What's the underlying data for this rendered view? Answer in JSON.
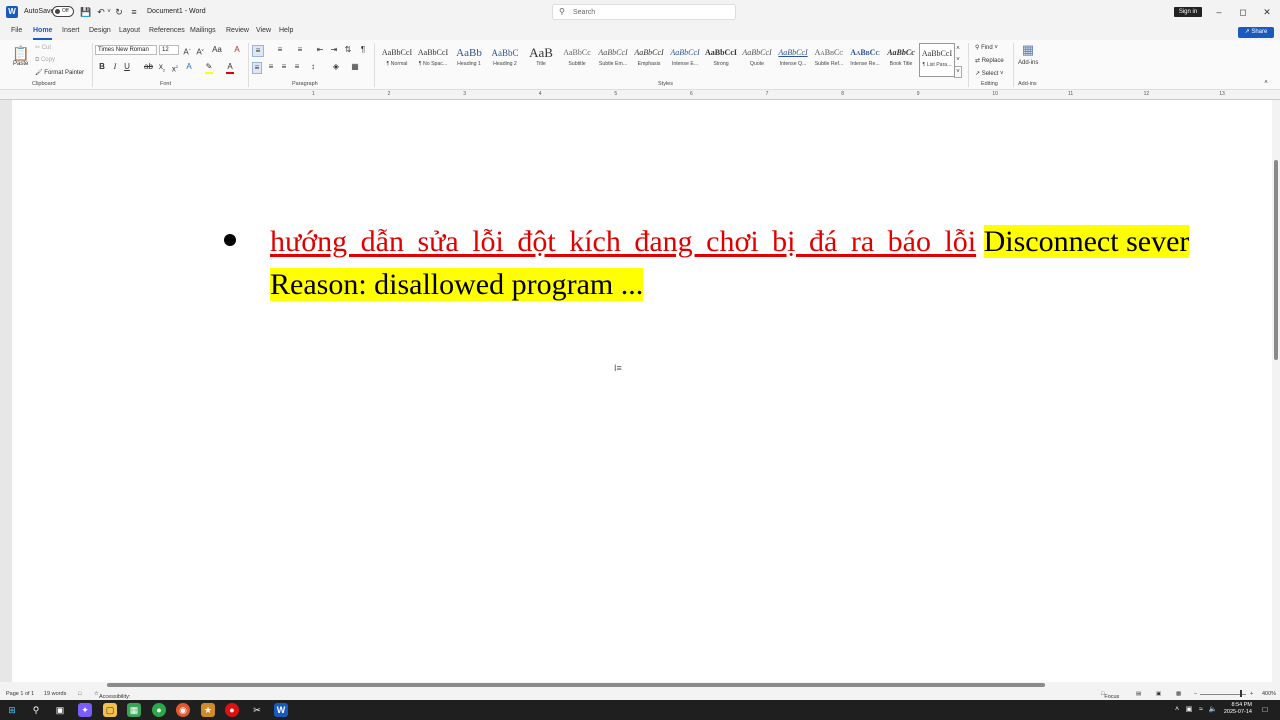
{
  "titlebar": {
    "autosave_label": "AutoSave",
    "autosave_state": "Off",
    "document_title": "Document1  -  Word",
    "search_placeholder": "Search",
    "signin_label": "Sign in"
  },
  "tabs": [
    "File",
    "Home",
    "Insert",
    "Design",
    "Layout",
    "References",
    "Mailings",
    "Review",
    "View",
    "Help"
  ],
  "share_label": "Share",
  "ribbon": {
    "clipboard": {
      "paste": "Paste",
      "cut": "Cut",
      "copy": "Copy",
      "format_painter": "Format Painter",
      "group_label": "Clipboard"
    },
    "font": {
      "font_name": "Times New Roman",
      "font_size": "12",
      "group_label": "Font"
    },
    "paragraph": {
      "group_label": "Paragraph"
    },
    "styles": {
      "group_label": "Styles",
      "items": [
        {
          "sample": "AaBbCcI",
          "label": "¶ Normal"
        },
        {
          "sample": "AaBbCcI",
          "label": "¶ No Spac..."
        },
        {
          "sample": "AaBb",
          "label": "Heading 1"
        },
        {
          "sample": "AaBbC",
          "label": "Heading 2"
        },
        {
          "sample": "AaB",
          "label": "Title"
        },
        {
          "sample": "AaBbCc",
          "label": "Subtitle"
        },
        {
          "sample": "AaBbCcI",
          "label": "Subtle Em..."
        },
        {
          "sample": "AaBbCcI",
          "label": "Emphasis"
        },
        {
          "sample": "AaBbCcI",
          "label": "Intense E..."
        },
        {
          "sample": "AaBbCcI",
          "label": "Strong"
        },
        {
          "sample": "AaBbCcI",
          "label": "Quote"
        },
        {
          "sample": "AaBbCcI",
          "label": "Intense Q..."
        },
        {
          "sample": "AaBbCc",
          "label": "Subtle Ref..."
        },
        {
          "sample": "AaBbCc",
          "label": "Intense Re..."
        },
        {
          "sample": "AaBbCc",
          "label": "Book Title"
        },
        {
          "sample": "AaBbCcI",
          "label": "¶ List Para..."
        }
      ]
    },
    "editing": {
      "find": "Find",
      "replace": "Replace",
      "select": "Select",
      "group_label": "Editing"
    },
    "addins": {
      "button": "Add-ins",
      "group_label": "Add-ins"
    }
  },
  "ruler_numbers": [
    "1",
    "2",
    "3",
    "4",
    "5",
    "6",
    "7",
    "8",
    "9",
    "10",
    "11",
    "12",
    "13",
    "14"
  ],
  "document": {
    "red_text": "hướng dẫn sửa lỗi đột kích đang chơi bị đá ra báo lỗi",
    "highlight_text": "Disconnect sever Reason: disallowed program ..."
  },
  "statusbar": {
    "page": "Page 1 of 1",
    "words": "19 words",
    "accessibility": "Accessibility: Investigate",
    "focus": "Focus",
    "zoom": "400%"
  },
  "taskbar": {
    "time": "8:54 PM",
    "date": "2025-07-14"
  },
  "colors": {
    "word_blue": "#185abd",
    "text_red": "#e00000",
    "highlight_yellow": "#ffff00"
  }
}
